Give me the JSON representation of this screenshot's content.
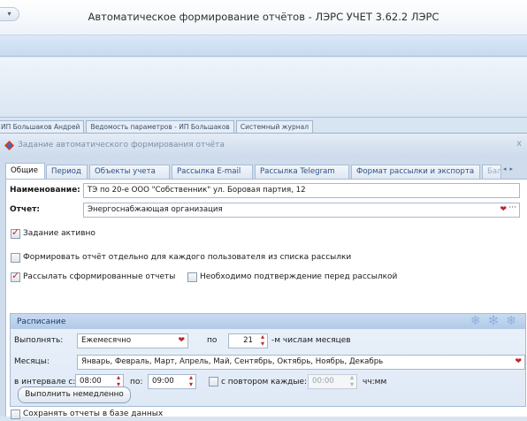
{
  "window": {
    "title": "Автоматическое формирование отчётов - ЛЭРС УЧЕТ 3.62.2 ЛЭРС",
    "quick_access_icon": "dropdown-arrow-icon"
  },
  "doc_tabs": [
    "ИП Большаков Андрей",
    "Ведомость параметров - ИП Большаков",
    "Системный журнал"
  ],
  "dialog": {
    "title": "Задание автоматического формирования отчёта",
    "close_label": "x",
    "tabs": [
      "Общие",
      "Период",
      "Объекты учета",
      "Рассылка E-mail",
      "Рассылка Telegram",
      "Формат рассылки и экспорта",
      "Бала"
    ],
    "active_tab": "Общие",
    "name_label": "Наименование:",
    "name_value": "ТЭ по 20-е ООО \"Собственник\" ул. Боровая партия, 12",
    "report_label": "Отчет:",
    "report_value": "Энергоснабжающая организация",
    "report_ellipsis": "···",
    "task_active": {
      "label": "Задание активно",
      "checked": true
    },
    "per_user": {
      "label": "Формировать отчёт отдельно для каждого пользователя из списка рассылки",
      "checked": false
    },
    "send_reports": {
      "label": "Рассылать сформированные отчеты",
      "checked": true
    },
    "confirm_before_send": {
      "label": "Необходимо подтверждение перед рассылкой",
      "checked": false
    },
    "schedule": {
      "title": "Расписание",
      "run_label": "Выполнять:",
      "run_value": "Ежемесячно",
      "by_label": "по",
      "day_value": "21",
      "day_suffix": "-м числам месяцев",
      "months_label": "Месяцы:",
      "months_value": "Январь, Февраль, Март, Апрель, Май, Сентябрь, Октябрь, Ноябрь, Декабрь",
      "interval_from_label": "в интервале с:",
      "interval_from": "08:00",
      "interval_to_label": "по:",
      "interval_to": "09:00",
      "repeat": {
        "label": "с повтором каждые:",
        "checked": false
      },
      "repeat_value": "00:00",
      "repeat_unit": "чч:мм",
      "run_now_button": "Выполнить немедленно"
    },
    "save_in_db": {
      "label": "Сохранять отчеты в базе данных",
      "checked": false
    }
  },
  "colors": {
    "accent": "#c0272d",
    "panel_blue": "#dfe9f6"
  }
}
